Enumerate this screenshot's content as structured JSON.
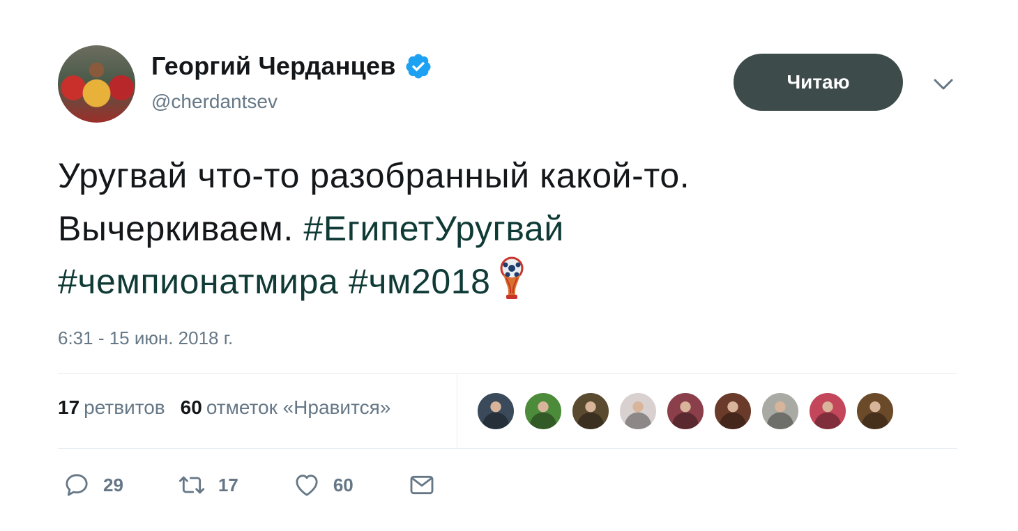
{
  "user": {
    "name": "Георгий Черданцев",
    "handle": "@cherdantsev",
    "verified": true
  },
  "follow_button": {
    "label": "Читаю",
    "color": "#3d4b4b"
  },
  "tweet": {
    "line1": "Уругвай что-то разобранный какой-то.",
    "line2_text": "Вычеркиваем. ",
    "hashtag1": "#ЕгипетУругвай",
    "hashtag2": "#чемпионатмира",
    "hashtag3": "#чм2018",
    "emoji_icon": "world-cup-trophy-icon",
    "timestamp": "6:31 - 15 июн. 2018 г."
  },
  "stats": {
    "retweets_count": "17",
    "retweets_label": "ретвитов",
    "likes_count": "60",
    "likes_label": "отметок «Нравится»"
  },
  "likers": [
    {
      "icon": "avatar",
      "color": "#3a4a5a"
    },
    {
      "icon": "avatar",
      "color": "#4c8b3a"
    },
    {
      "icon": "avatar",
      "color": "#5a4a30"
    },
    {
      "icon": "avatar",
      "color": "#d9d0d0"
    },
    {
      "icon": "avatar",
      "color": "#8a3f4a"
    },
    {
      "icon": "avatar",
      "color": "#6a3b2a"
    },
    {
      "icon": "avatar",
      "color": "#a9aaa4"
    },
    {
      "icon": "avatar",
      "color": "#c4465a"
    },
    {
      "icon": "avatar",
      "color": "#6b4a2a"
    }
  ],
  "actions": {
    "reply_count": "29",
    "retweet_count": "17",
    "like_count": "60"
  },
  "colors": {
    "text": "#14171a",
    "muted": "#657786",
    "verified": "#1da1f2",
    "divider": "#e6ecf0"
  }
}
